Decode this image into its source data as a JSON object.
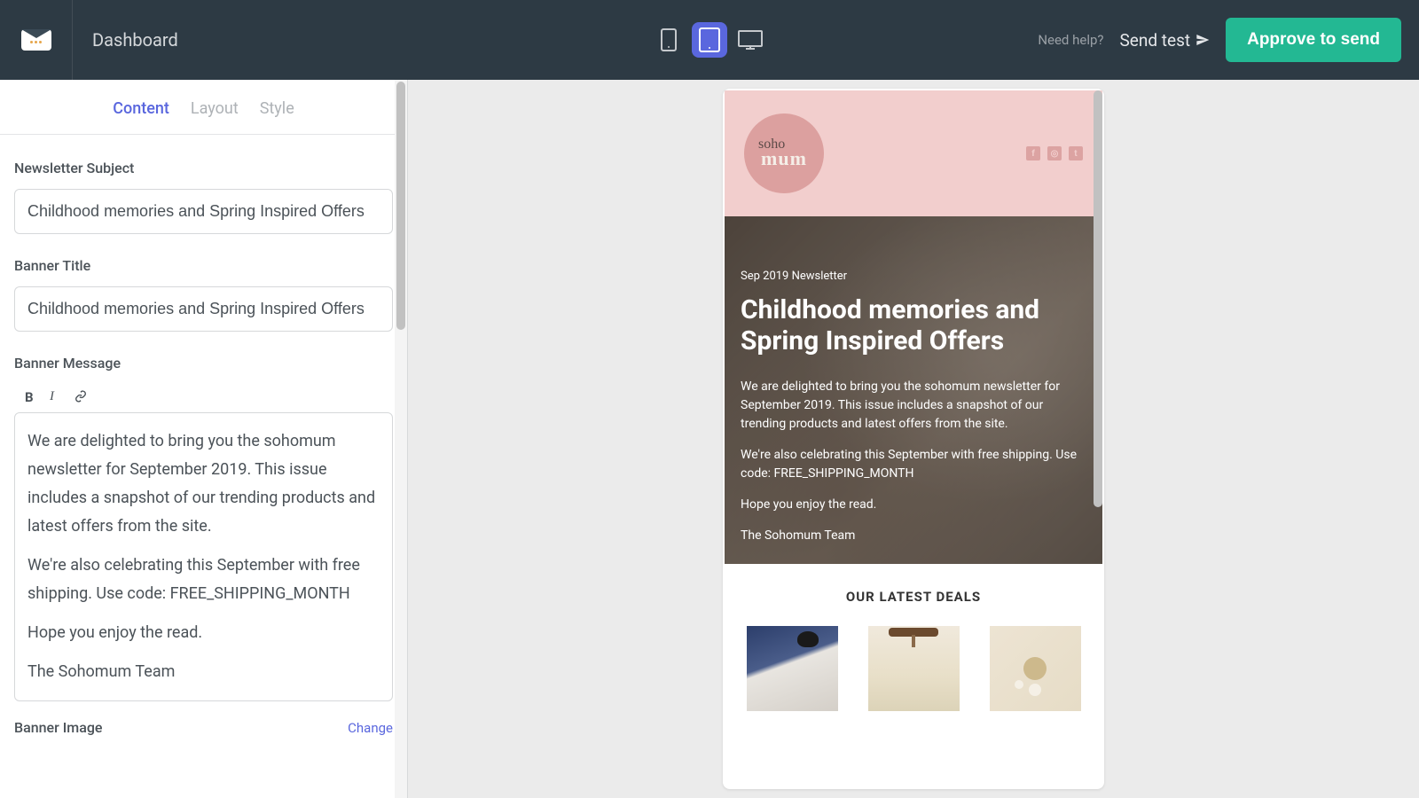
{
  "topbar": {
    "dashboard": "Dashboard",
    "need_help": "Need help?",
    "send_test": "Send test",
    "approve": "Approve to send"
  },
  "tabs": {
    "content": "Content",
    "layout": "Layout",
    "style": "Style"
  },
  "form": {
    "subject_label": "Newsletter Subject",
    "subject_value": "Childhood memories and Spring Inspired Offers",
    "banner_title_label": "Banner Title",
    "banner_title_value": "Childhood memories and Spring Inspired Offers",
    "banner_message_label": "Banner Message",
    "banner_message_p1": "We are delighted to bring you the sohomum newsletter for September 2019. This issue includes a snapshot of our trending products and latest offers from the site.",
    "banner_message_p2": "We're also celebrating this September with free shipping. Use code: FREE_SHIPPING_MONTH",
    "banner_message_p3": "Hope you enjoy the read.",
    "banner_message_p4": "The Sohomum Team",
    "banner_image_label": "Banner Image",
    "change": "Change"
  },
  "preview": {
    "brand_script": "soho",
    "brand_main": "mum",
    "date_tag": "Sep 2019 Newsletter",
    "title": "Childhood memories and Spring Inspired Offers",
    "p1": "We are delighted to bring you the sohomum newsletter for September 2019. This issue includes a snapshot of our trending products and latest offers from the site.",
    "p2": "We're also celebrating this September with free shipping. Use code: FREE_SHIPPING_MONTH",
    "p3": "Hope you enjoy the read.",
    "p4": "The Sohomum Team",
    "deals_title": "OUR LATEST DEALS"
  }
}
